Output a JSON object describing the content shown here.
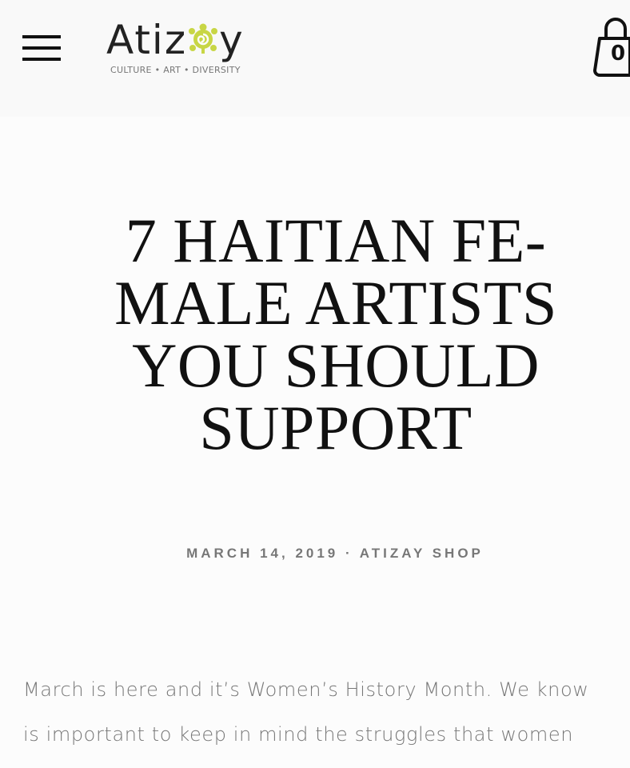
{
  "header": {
    "menu_icon": "hamburger-menu-icon",
    "logo": {
      "text_before": "Atiz",
      "emblem_icon": "turtle-emblem-icon",
      "text_after": "y",
      "tagline": "CULTURE • ART • DIVERSITY",
      "emblem_color": "#c8d645"
    },
    "cart": {
      "icon": "shopping-bag-icon",
      "count": "0"
    }
  },
  "article": {
    "title": "7 HAITIAN FE-MALE ARTISTS YOU SHOULD SUPPORT",
    "title_lines": [
      "7 HAITIAN FE-",
      "MALE ARTISTS",
      "YOU SHOULD",
      "SUPPORT"
    ],
    "meta": "MARCH 14, 2019 · ATIZAY SHOP",
    "body_lines": [
      "March is here and it’s Women’s History Month.  We know",
      "is important to keep in mind the struggles that women"
    ]
  }
}
